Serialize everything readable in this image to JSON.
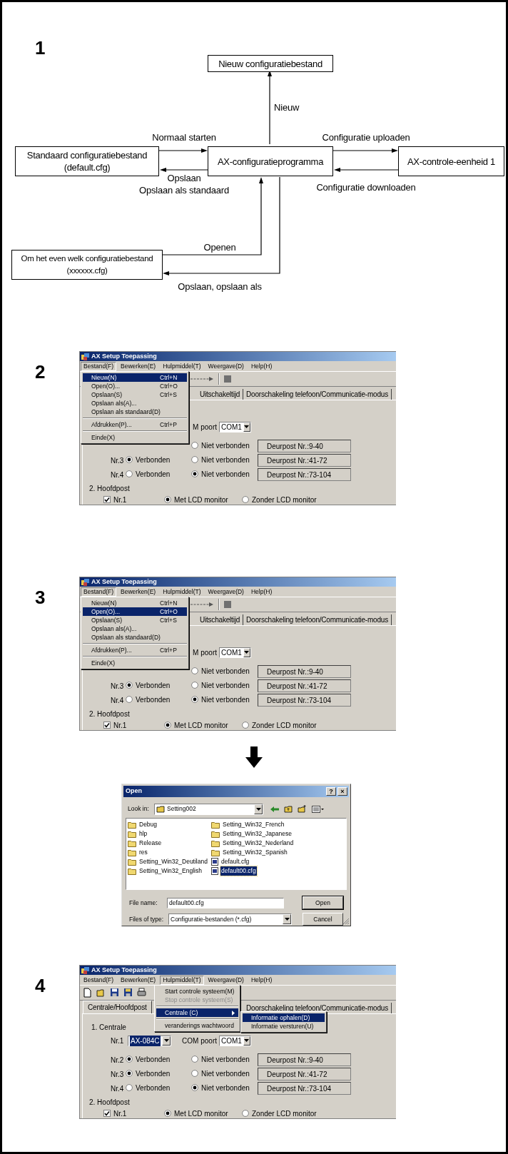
{
  "step_1": {
    "number": "1",
    "nodes": [
      {
        "label": "Nieuw configuratiebestand"
      },
      {
        "label": "Standaard configuratiebestand\n(default.cfg)"
      },
      {
        "label": "AX-configuratieprogramma"
      },
      {
        "label": "AX-controle-eenheid 1"
      },
      {
        "label": "Om het even welk configuratiebestand\n(xxxxxx.cfg)"
      }
    ],
    "edge_labels": [
      "Nieuw",
      "Normaal starten",
      "Configuratie uploaden",
      "Opslaan\nOpslaan als standaard",
      "Configuratie downloaden",
      "Openen",
      "Opslaan, opslaan als"
    ]
  },
  "step_2": {
    "number": "2",
    "window": {
      "title": "AX Setup Toepassing",
      "menu_bar": [
        {
          "label": "Bestand(F)",
          "selected": true
        },
        {
          "label": "Bewerken(E)",
          "selected": false
        },
        {
          "label": "Hulpmiddel(T)",
          "selected": false
        },
        {
          "label": "Weergave(D)",
          "selected": false
        },
        {
          "label": "Help(H)",
          "selected": false
        }
      ],
      "tabs": [
        {
          "label": "Uitschakeltijd",
          "selected": false
        },
        {
          "label": "Doorschakeling telefoon/Communicatie-modus",
          "selected": false
        }
      ],
      "centrale": {
        "port_label": "M poort",
        "port": "COM1"
      },
      "units": [
        {
          "not_connected": {
            "label": "Niet verbonden",
            "selected": false
          },
          "range": "Deurpost Nr.:9-40"
        },
        {
          "label": "Nr.3",
          "connected": {
            "label": "Verbonden",
            "selected": true
          },
          "not_connected": {
            "label": "Niet verbonden",
            "selected": false
          },
          "range": "Deurpost Nr.:41-72"
        },
        {
          "label": "Nr.4",
          "connected": {
            "label": "Verbonden",
            "selected": false
          },
          "not_connected": {
            "label": "Niet verbonden",
            "selected": true
          },
          "range": "Deurpost Nr.:73-104"
        }
      ],
      "hoofdpost": {
        "heading": "2. Hoofdpost",
        "stations": [
          {
            "label": "Nr.1",
            "checked": true,
            "options": [
              {
                "label": "Met LCD monitor",
                "selected": true
              },
              {
                "label": "Zonder LCD monitor",
                "selected": false
              }
            ]
          }
        ]
      },
      "menu": {
        "items": [
          {
            "kind": "item",
            "label": "Nieuw(N)",
            "shortcut": "Ctrl+N",
            "selected": true,
            "disabled": false
          },
          {
            "kind": "item",
            "label": "Open(O)...",
            "shortcut": "Ctrl+O",
            "selected": false,
            "disabled": false
          },
          {
            "kind": "item",
            "label": "Opslaan(S)",
            "shortcut": "Ctrl+S",
            "selected": false,
            "disabled": false
          },
          {
            "kind": "item",
            "label": "Opslaan als(A)...",
            "selected": false,
            "disabled": false
          },
          {
            "kind": "item",
            "label": "Opslaan als standaard(D)",
            "selected": false,
            "disabled": false
          },
          {
            "kind": "separator"
          },
          {
            "kind": "item",
            "label": "Afdrukken(P)...",
            "shortcut": "Ctrl+P",
            "selected": false,
            "disabled": false
          },
          {
            "kind": "separator"
          },
          {
            "kind": "item",
            "label": "Einde(X)",
            "selected": false,
            "disabled": false
          }
        ]
      }
    }
  },
  "step_3": {
    "number": "3",
    "window": {
      "title": "AX Setup Toepassing",
      "menu_bar": [
        {
          "label": "Bestand(F)",
          "selected": true
        },
        {
          "label": "Bewerken(E)",
          "selected": false
        },
        {
          "label": "Hulpmiddel(T)",
          "selected": false
        },
        {
          "label": "Weergave(D)",
          "selected": false
        },
        {
          "label": "Help(H)",
          "selected": false
        }
      ],
      "tabs": [
        {
          "label": "Uitschakeltijd",
          "selected": false
        },
        {
          "label": "Doorschakeling telefoon/Communicatie-modus",
          "selected": false
        }
      ],
      "centrale": {
        "port_label": "M poort",
        "port": "COM1"
      },
      "units": [
        {
          "not_connected": {
            "label": "Niet verbonden",
            "selected": false
          },
          "range": "Deurpost Nr.:9-40"
        },
        {
          "label": "Nr.3",
          "connected": {
            "label": "Verbonden",
            "selected": true
          },
          "not_connected": {
            "label": "Niet verbonden",
            "selected": false
          },
          "range": "Deurpost Nr.:41-72"
        },
        {
          "label": "Nr.4",
          "connected": {
            "label": "Verbonden",
            "selected": false
          },
          "not_connected": {
            "label": "Niet verbonden",
            "selected": true
          },
          "range": "Deurpost Nr.:73-104"
        }
      ],
      "hoofdpost": {
        "heading": "2. Hoofdpost",
        "stations": [
          {
            "label": "Nr.1",
            "checked": true,
            "options": [
              {
                "label": "Met LCD monitor",
                "selected": true
              },
              {
                "label": "Zonder LCD monitor",
                "selected": false
              }
            ]
          }
        ]
      },
      "menu": {
        "items": [
          {
            "kind": "item",
            "label": "Nieuw(N)",
            "shortcut": "Ctrl+N",
            "selected": false,
            "disabled": false
          },
          {
            "kind": "item",
            "label": "Open(O)...",
            "shortcut": "Ctrl+O",
            "selected": true,
            "disabled": false
          },
          {
            "kind": "item",
            "label": "Opslaan(S)",
            "shortcut": "Ctrl+S",
            "selected": false,
            "disabled": false
          },
          {
            "kind": "item",
            "label": "Opslaan als(A)...",
            "selected": false,
            "disabled": false
          },
          {
            "kind": "item",
            "label": "Opslaan als standaard(D)",
            "selected": false,
            "disabled": false
          },
          {
            "kind": "separator"
          },
          {
            "kind": "item",
            "label": "Afdrukken(P)...",
            "shortcut": "Ctrl+P",
            "selected": false,
            "disabled": false
          },
          {
            "kind": "separator"
          },
          {
            "kind": "item",
            "label": "Einde(X)",
            "selected": false,
            "disabled": false
          }
        ]
      }
    }
  },
  "open_dialog": {
    "title": "Open",
    "title_buttons": [
      "?",
      "×"
    ],
    "look_in_label": "Look in:",
    "look_in": "Setting002",
    "files": [
      {
        "name": "Debug",
        "kind": "folder",
        "selected": false
      },
      {
        "name": "hlp",
        "kind": "folder",
        "selected": false
      },
      {
        "name": "Release",
        "kind": "folder",
        "selected": false
      },
      {
        "name": "res",
        "kind": "folder",
        "selected": false
      },
      {
        "name": "Setting_Win32_Deutiland",
        "kind": "folder",
        "selected": false
      },
      {
        "name": "Setting_Win32_English",
        "kind": "folder",
        "selected": false
      },
      {
        "name": "Setting_Win32_French",
        "kind": "folder",
        "selected": false
      },
      {
        "name": "Setting_Win32_Japanese",
        "kind": "folder",
        "selected": false
      },
      {
        "name": "Setting_Win32_Nederland",
        "kind": "folder",
        "selected": false
      },
      {
        "name": "Setting_Win32_Spanish",
        "kind": "folder",
        "selected": false
      },
      {
        "name": "default.cfg",
        "kind": "file",
        "selected": false
      },
      {
        "name": "default00.cfg",
        "kind": "file",
        "selected": true
      }
    ],
    "file_name_label": "File name:",
    "file_name": "default00.cfg",
    "file_type_label": "Files of type:",
    "file_type": "Configuratie-bestanden (*.cfg)",
    "buttons": [
      "Open",
      "Cancel"
    ]
  },
  "step_4": {
    "number": "4",
    "window": {
      "title": "AX Setup Toepassing",
      "menu_bar": [
        {
          "label": "Bestand(F)",
          "selected": false
        },
        {
          "label": "Bewerken(E)",
          "selected": false
        },
        {
          "label": "Hulpmiddel(T)",
          "selected": true
        },
        {
          "label": "Weergave(D)",
          "selected": false
        },
        {
          "label": "Help(H)",
          "selected": false
        }
      ],
      "tabs": [
        {
          "label": "Centrale/Hoofdpost",
          "selected": true
        },
        {
          "label": "Doorschakeling telefoon/Communicatie-modus",
          "selected": false
        }
      ],
      "centrale": {
        "heading": "1. Centrale",
        "unit_label": "Nr.1",
        "model": "AX-084C",
        "model_highlighted": true,
        "port_label": "COM poort",
        "port": "COM1"
      },
      "units": [
        {
          "label": "Nr.2",
          "connected": {
            "label": "Verbonden",
            "selected": true
          },
          "not_connected": {
            "label": "Niet verbonden",
            "selected": false
          },
          "range": "Deurpost Nr.:9-40"
        },
        {
          "label": "Nr.3",
          "connected": {
            "label": "Verbonden",
            "selected": true
          },
          "not_connected": {
            "label": "Niet verbonden",
            "selected": false
          },
          "range": "Deurpost Nr.:41-72"
        },
        {
          "label": "Nr.4",
          "connected": {
            "label": "Verbonden",
            "selected": false
          },
          "not_connected": {
            "label": "Niet verbonden",
            "selected": true
          },
          "range": "Deurpost Nr.:73-104"
        }
      ],
      "hoofdpost": {
        "heading": "2. Hoofdpost",
        "stations": [
          {
            "label": "Nr.1",
            "checked": true,
            "options": [
              {
                "label": "Met LCD monitor",
                "selected": true
              },
              {
                "label": "Zonder LCD monitor",
                "selected": false
              }
            ]
          }
        ]
      },
      "menu": {
        "items": [
          {
            "kind": "item",
            "label": "Start controle systeem(M)",
            "selected": false,
            "disabled": false
          },
          {
            "kind": "item",
            "label": "Stop controle systeem(S)",
            "selected": false,
            "disabled": true
          },
          {
            "kind": "separator"
          },
          {
            "kind": "submenu",
            "label": "Centrale (C)",
            "selected": true,
            "disabled": false
          },
          {
            "kind": "separator"
          },
          {
            "kind": "item",
            "label": "veranderings wachtwoord",
            "selected": false,
            "disabled": false
          }
        ],
        "submenu": {
          "items": [
            {
              "kind": "item",
              "label": "Informatie ophalen(D)",
              "selected": true,
              "disabled": false
            },
            {
              "kind": "item",
              "label": "Informatie versturen(U)",
              "selected": false,
              "disabled": false
            }
          ]
        }
      }
    }
  }
}
